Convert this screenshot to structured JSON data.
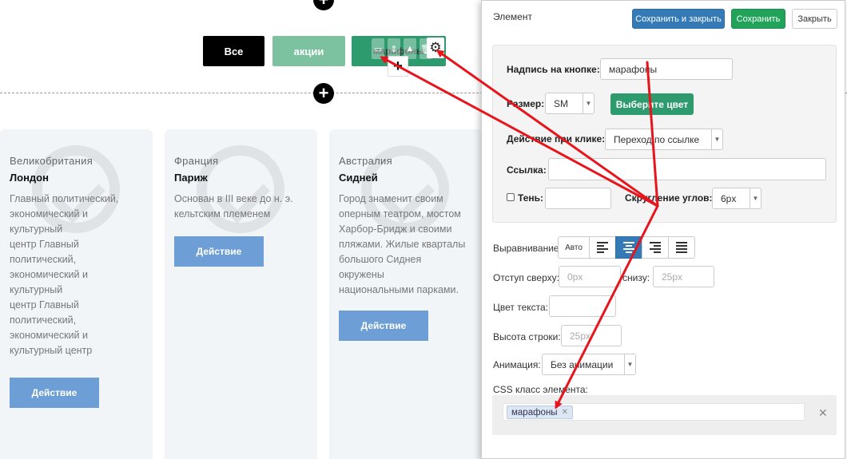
{
  "page": {
    "filters": [
      {
        "label": "Все"
      },
      {
        "label": "акции"
      },
      {
        "label": "марафоны"
      }
    ],
    "cards": [
      {
        "country": "Великобритания",
        "city": "Лондон",
        "desc_lines": [
          "Главный политический,",
          "экономический и",
          "культурный",
          "центр Главный",
          "политический,",
          "экономический и",
          "культурный",
          "центр Главный",
          "политический,",
          "экономический и",
          "культурный центр"
        ],
        "action": "Действие"
      },
      {
        "country": "Франция",
        "city": "Париж",
        "desc_lines": [
          "Основан в III веке до н. э.",
          "кельтским племенем"
        ],
        "action": "Действие"
      },
      {
        "country": "Австралия",
        "city": "Сидней",
        "desc_lines": [
          "Город знаменит своим",
          "оперным театром, мостом",
          "Харбор-Бридж и своими",
          "пляжами. Жилые кварталы",
          "большого Сиднея",
          "окружены",
          "национальными парками."
        ],
        "action": "Действие"
      }
    ]
  },
  "panel": {
    "title": "Элемент",
    "save_close": "Сохранить и закрыть",
    "save": "Сохранить",
    "close": "Закрыть",
    "button_text_label": "Надпись на кнопке:",
    "button_text_value": "марафоны",
    "size_label": "Размер:",
    "size_value": "SM",
    "choose_color": "Выберите цвет",
    "click_action_label": "Действие при клике:",
    "click_action_value": "Переход по ссылке",
    "link_label": "Ссылка:",
    "link_value": "",
    "shadow_label": "Тень:",
    "rounding_label": "Скругление углов:",
    "rounding_value": "6px",
    "align_label": "Выравнивание",
    "align_auto": "Авто",
    "margin_top_label": "Отступ сверху:",
    "margin_top_value": "0px",
    "margin_bottom_label": "снизу:",
    "margin_bottom_value": "25px",
    "text_color_label": "Цвет текста:",
    "line_height_label": "Высота строки:",
    "line_height_value": "25px",
    "animation_label": "Анимация:",
    "animation_value": "Без анимации",
    "css_class_label": "CSS класс элемента:",
    "css_class_tag": "марафоны"
  },
  "colors": {
    "primary": "#337ab7",
    "success": "#22a35a",
    "filter_promo": "#7cc2a0",
    "filter_marathon": "#2e9b6f",
    "card_action": "#6d9fd6",
    "arrow": "#e8141c"
  }
}
